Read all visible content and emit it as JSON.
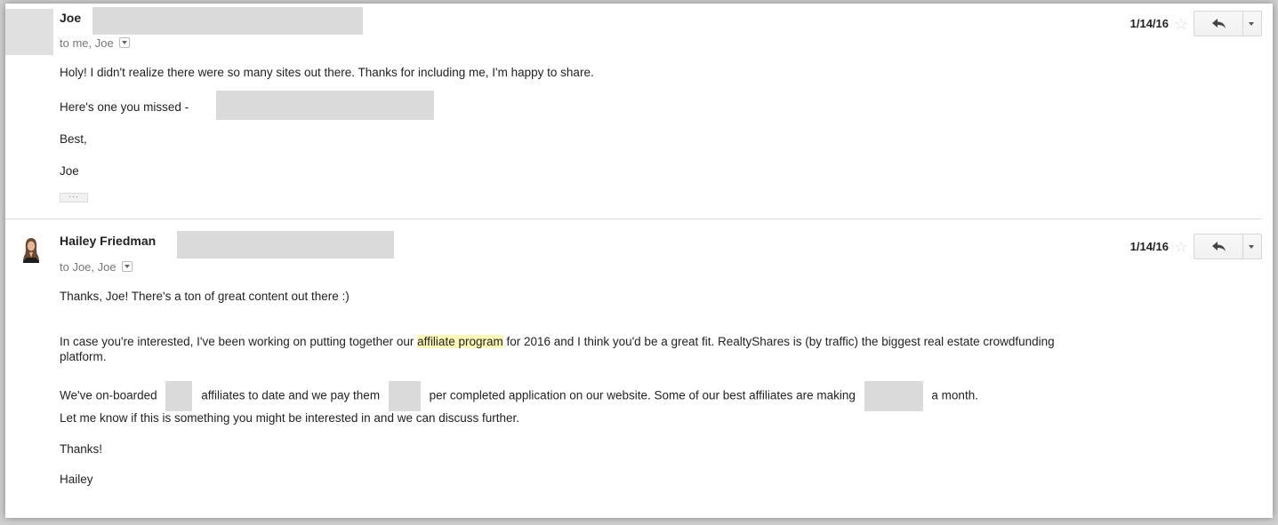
{
  "messages": [
    {
      "sender": "Joe",
      "recipients": "to me, Joe",
      "date": "1/14/16",
      "body": {
        "l1": "Holy! I didn't realize there were so many sites out there. Thanks for including me, I'm happy to share.",
        "l2": "Here's one you missed -",
        "l3": "Best,",
        "l4": "Joe"
      },
      "ellipsis": "···"
    },
    {
      "sender": "Hailey Friedman",
      "recipients": "to Joe, Joe",
      "date": "1/14/16",
      "body": {
        "l1": "Thanks, Joe! There's a ton of great content out there :)",
        "l2a": "In case you're interested, I've been working on putting together our",
        "l2hl": "affiliate program",
        "l2b": "for 2016 and I think you'd be a great fit. RealtyShares is (by traffic) the biggest real estate crowdfunding",
        "l2c": "platform.",
        "l3a": "We've on-boarded",
        "l3b": "affiliates to date and we pay them",
        "l3c": "per completed application on our website. Some of our best affiliates are making",
        "l3d": "a month.",
        "l4": "Let me know if this is something you might be interested in and we can discuss further.",
        "l5": "Thanks!",
        "l6": "Hailey"
      }
    }
  ],
  "colors": {
    "highlight": "#fdf7b5",
    "redaction": "#dadada"
  },
  "icons": {
    "star": "star-outline-icon",
    "reply": "reply-arrow-icon",
    "more": "chevron-down-icon"
  }
}
